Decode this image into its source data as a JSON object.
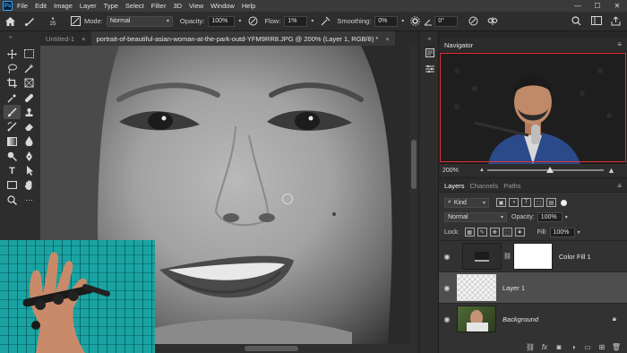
{
  "menubar": {
    "logo": "Ps",
    "items": [
      "File",
      "Edit",
      "Image",
      "Layer",
      "Type",
      "Select",
      "Filter",
      "3D",
      "View",
      "Window",
      "Help"
    ],
    "window_controls": [
      "—",
      "☐",
      "✕"
    ]
  },
  "options": {
    "brush_size": "25",
    "mode_label": "Mode:",
    "mode_value": "Normal",
    "opacity_label": "Opacity:",
    "opacity_value": "100%",
    "flow_label": "Flow:",
    "flow_value": "1%",
    "smoothing_label": "Smoothing:",
    "smoothing_value": "0%",
    "angle_value": "0°"
  },
  "tabs": [
    {
      "label": "Untitled-1",
      "close": "×"
    },
    {
      "label": "portrait-of-beautiful-asian-woman-at-the-park-outd-YFM9RR8.JPG @ 200% (Layer 1, RGB/8) *",
      "close": "×"
    }
  ],
  "navigator": {
    "title": "Navigator",
    "zoom": "200%",
    "highlight_color": "#e03131"
  },
  "layers_panel": {
    "tabs": [
      "Layers",
      "Channels",
      "Paths"
    ],
    "kind_label": "Kind",
    "blend_mode": "Normal",
    "opacity_label": "Opacity:",
    "opacity_value": "100%",
    "lock_label": "Lock:",
    "fill_label": "Fill:",
    "fill_value": "100%",
    "layers": [
      {
        "name": "Color Fill 1",
        "visible": true,
        "active": false
      },
      {
        "name": "Layer 1",
        "visible": true,
        "active": true
      },
      {
        "name": "Background",
        "visible": true,
        "active": false,
        "locked": true
      }
    ]
  },
  "colors": {
    "foreground": "#ffffff",
    "background": "#000000",
    "accent": "#31a8ff"
  }
}
